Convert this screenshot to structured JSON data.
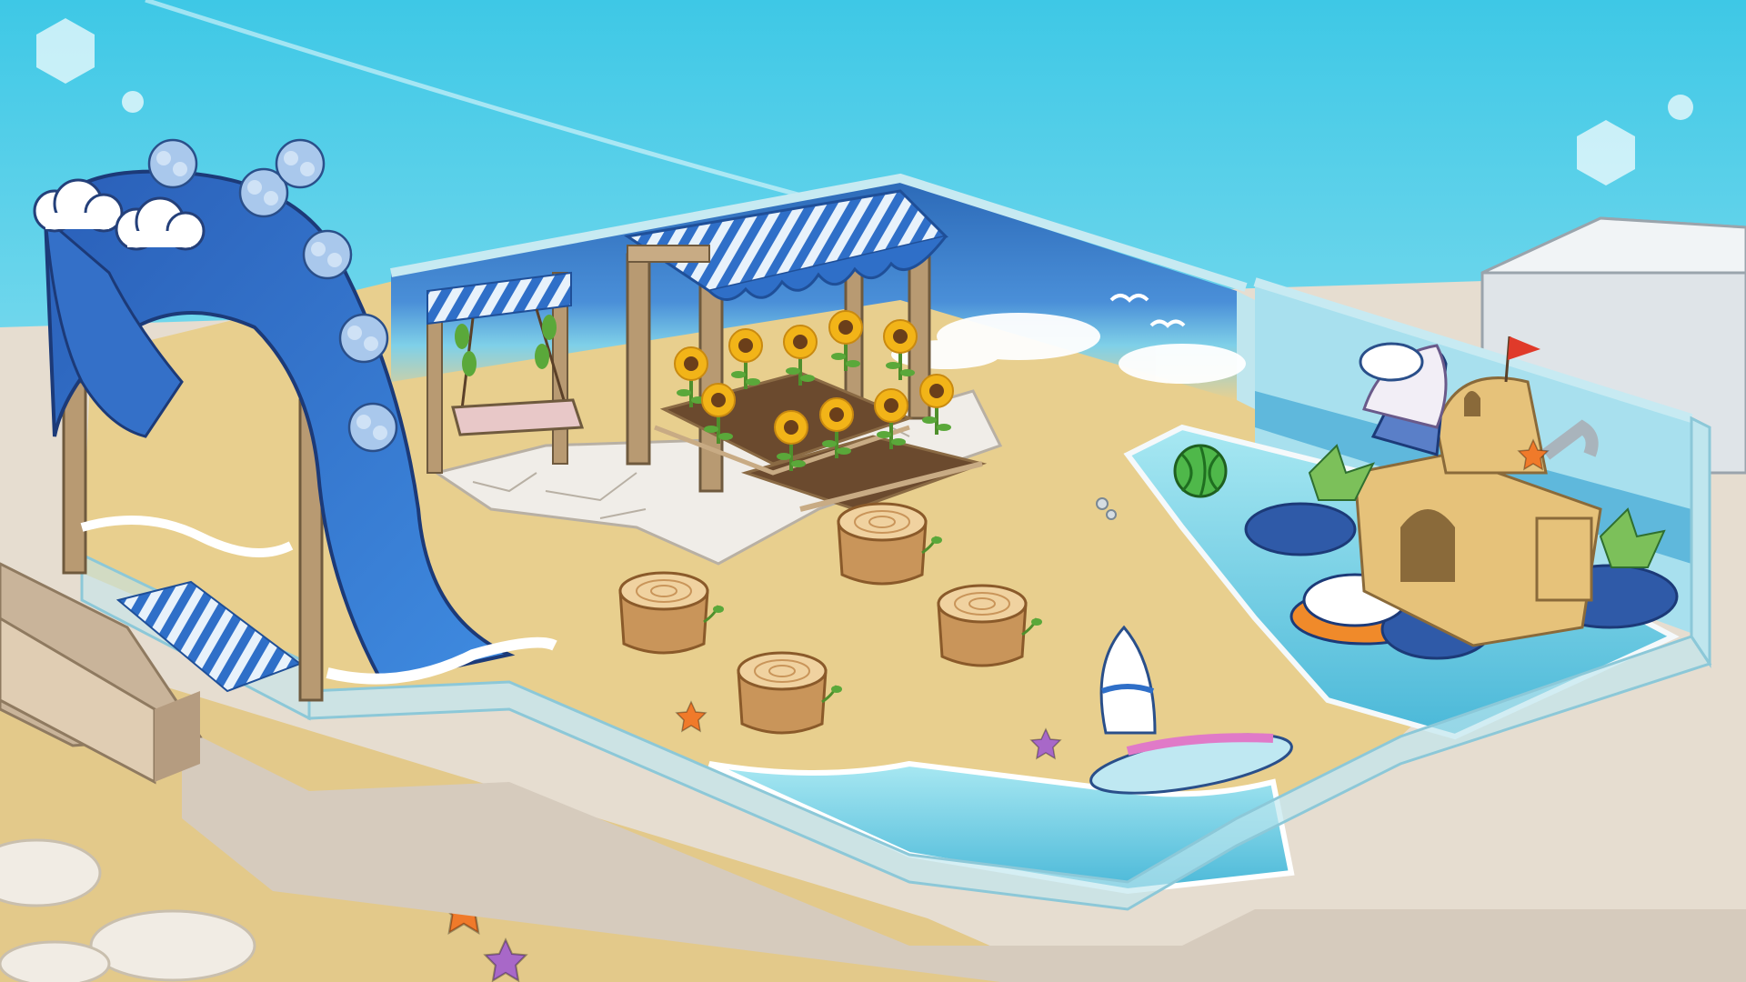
{
  "scene": {
    "theme": "beach-room",
    "colors": {
      "sky_top": "#3ec8e6",
      "sky_bottom": "#c9f3f8",
      "sand": "#e8cf8e",
      "sand_dark": "#d9b970",
      "floor_stone": "#e6ddd0",
      "glass_wall": "#bfe6ee",
      "water": "#7fd8ec",
      "water_deep": "#4ab8d8",
      "ocean_mural": "#3a7fc8",
      "wave_blue": "#2c6ec4",
      "wood": "#b89a72",
      "stump": "#c9955a",
      "sunflower": "#f2b418",
      "awning_blue": "#2f6fc8",
      "starfish_orange": "#f07a2a",
      "starfish_purple": "#a868c8",
      "surfboard_pink": "#e07ac8",
      "flag_red": "#e03a2a"
    },
    "icons": [
      "wave-arch-icon",
      "swing-icon",
      "awning-icon",
      "sunflower-icon",
      "stump-icon",
      "surfboard-icon",
      "sandcastle-icon",
      "ice-cream-icon",
      "watermelon-ball-icon",
      "starfish-icon",
      "seagull-icon",
      "cloud-icon"
    ],
    "counts": {
      "stumps": 4,
      "sunflowers": 10,
      "seagulls": 2
    }
  }
}
